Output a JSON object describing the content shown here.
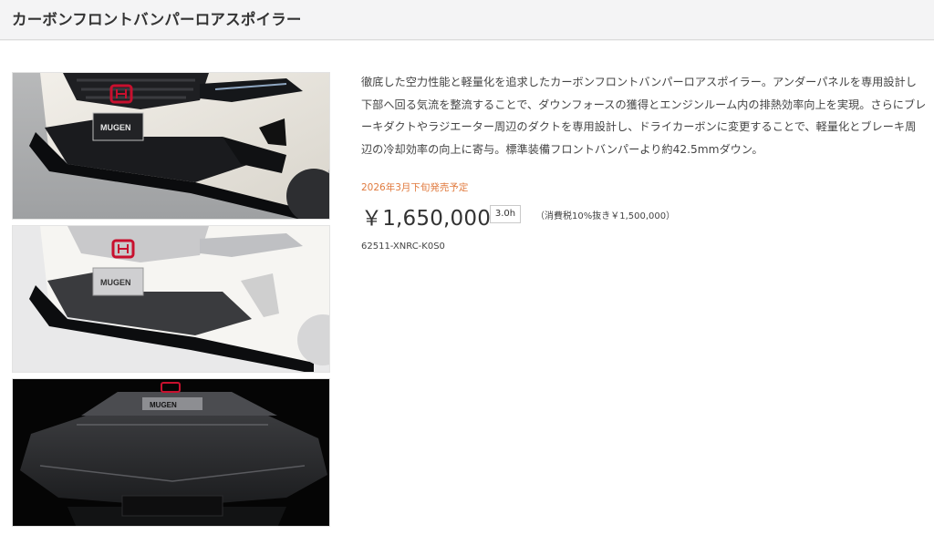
{
  "page": {
    "title": "カーボンフロントバンパーロアスポイラー"
  },
  "product": {
    "description": "徹底した空力性能と軽量化を追求したカーボンフロントバンパーロアスポイラー。アンダーパネルを専用設計し下部へ回る気流を整流することで、ダウンフォースの獲得とエンジンルーム内の排熱効率向上を実現。さらにブレーキダクトやラジエーター周辺のダクトを専用設計し、ドライカーボンに変更することで、軽量化とブレーキ周辺の冷却効率の向上に寄与。標準装備フロントバンパーより約42.5mmダウン。",
    "release": "2026年3月下旬発売予定",
    "price": "￥1,650,000",
    "work_hours": "3.0h",
    "tax_note": "（消費税10%抜き￥1,500,000）",
    "part_number": "62511-XNRC-K0S0"
  },
  "images": {
    "plate_text": "MUGEN"
  },
  "colors": {
    "accent": "#e07a3e",
    "emblem": "#c8102e"
  }
}
